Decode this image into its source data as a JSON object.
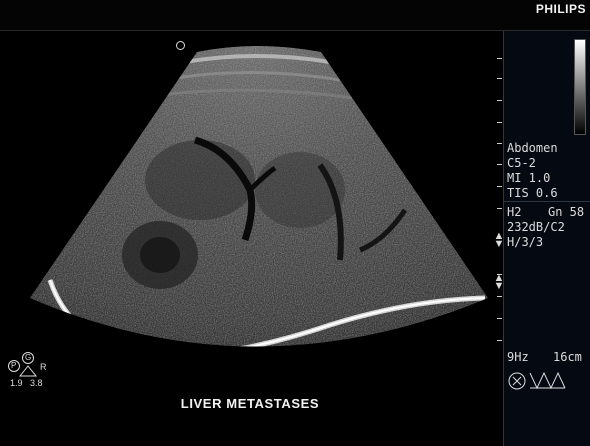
{
  "header": {
    "brand": "PHILIPS"
  },
  "info_panel": {
    "preset": "Abdomen",
    "probe": "C5-2",
    "mi": "MI 1.0",
    "tis": "TIS 0.6",
    "harmonic": "H2",
    "gain": "Gn 58",
    "dynamic_range": "232dB/C2",
    "persistence": "H/3/3",
    "frame_rate": "9Hz",
    "depth": "16cm"
  },
  "corner": {
    "p_label": "P",
    "g_label": "G",
    "r_label": "R",
    "val1": "1.9",
    "val2": "3.8"
  },
  "caption": "LIVER METASTASES",
  "colors": {
    "background": "#000000",
    "panel": "#050a12",
    "text": "#dcdcdc"
  }
}
